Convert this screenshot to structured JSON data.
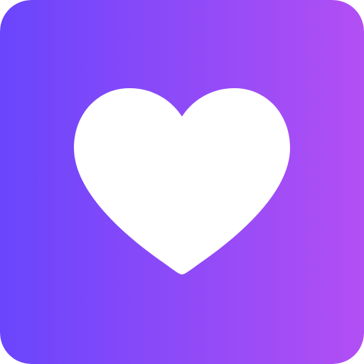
{
  "icon": {
    "name": "heart-icon",
    "colors": {
      "gradient_start": "#6a45fc",
      "gradient_end": "#b24ff4",
      "heart_fill": "#ffffff"
    }
  }
}
